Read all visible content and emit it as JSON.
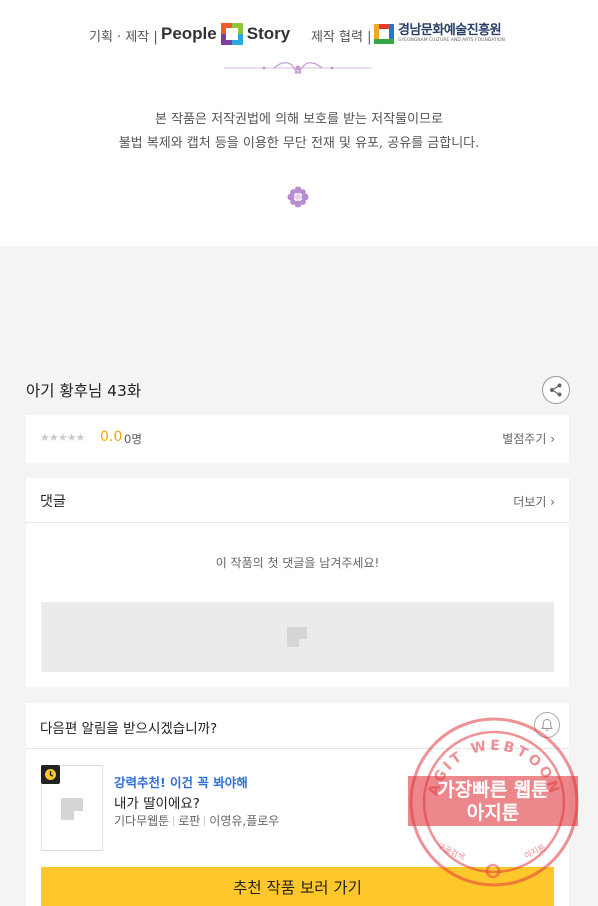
{
  "credits": {
    "plan_label": "기획 · 제작 |",
    "partner_label": "제작 협력 |",
    "people_word1": "People",
    "people_word2": "Story",
    "partner_name": "경남문화예술진흥원",
    "partner_name_en": "GYEONGNAM CULTURE AND ARTS FOUNDATION",
    "notice_line1": "본 작품은 저작권법에 의해 보호를 받는 저작물이므로",
    "notice_line2": "불법 복제와 캡처 등을 이용한 무단 전재 및 유포, 공유를 금합니다."
  },
  "episode": {
    "title": "아기 황후님 43화"
  },
  "rating": {
    "stars": "★★★★★",
    "stars_filled": 0,
    "score": "0.0",
    "count": "0명",
    "rate_link": "별점주기 ›"
  },
  "comments": {
    "title": "댓글",
    "more": "더보기 ›",
    "empty_text": "이 작품의 첫 댓글을 남겨주세요!"
  },
  "next": {
    "question": "다음편 알림을 받으시겠습니까?",
    "rec_tag": "강력추천! 이건 꼭 봐야해",
    "rec_title": "내가 딸이에요?",
    "meta": [
      "기다무웹툰",
      "로판",
      "이영유,플로우"
    ],
    "cta": "추천 작품 보러 가기"
  },
  "stamp": {
    "ring_text": "AGIT WEBTOON",
    "line1": "가장빠른 웹툰",
    "line2": "아지툰",
    "small_left": "구글검색",
    "small_right": "아지툰"
  },
  "colors": {
    "accent_yellow": "#fec72b",
    "score_orange": "#f0a800",
    "rec_blue": "#2f6fd4",
    "stamp_red": "#e0393e"
  }
}
